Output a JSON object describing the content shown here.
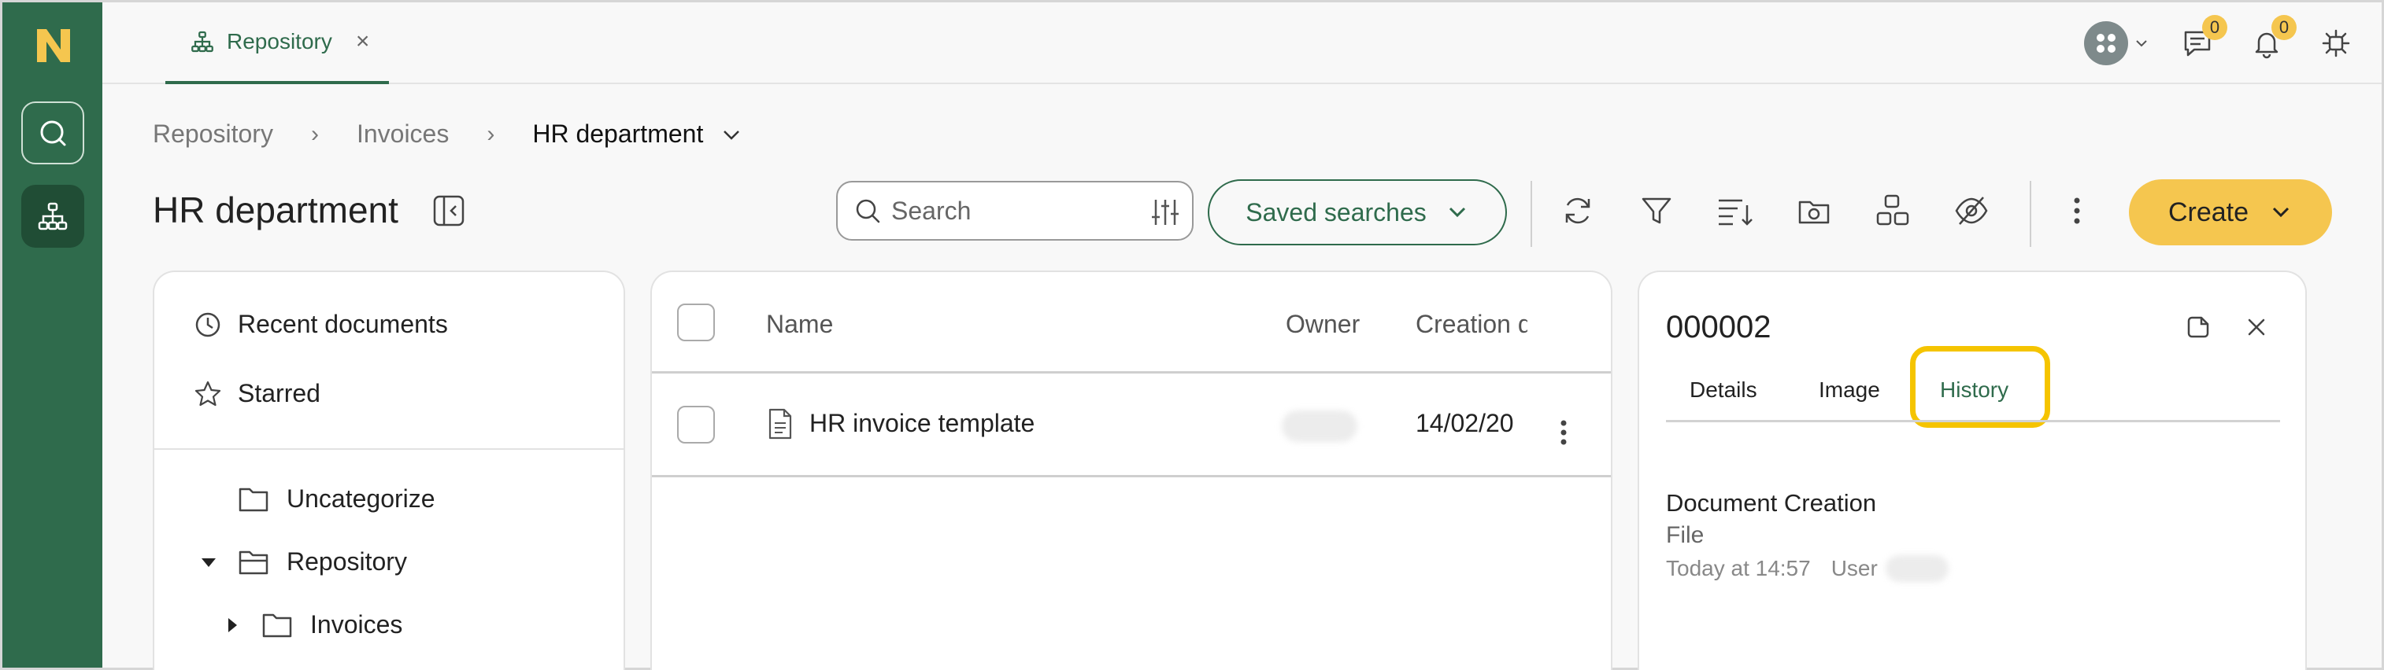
{
  "app": {
    "tab_label": "Repository",
    "tab_close": "×"
  },
  "header": {
    "messages_badge": "0",
    "notifications_badge": "0"
  },
  "breadcrumb": {
    "items": [
      "Repository",
      "Invoices"
    ],
    "current": "HR department",
    "separator": "›"
  },
  "page": {
    "title": "HR department"
  },
  "toolbar": {
    "search_placeholder": "Search",
    "saved_searches_label": "Saved searches",
    "create_label": "Create"
  },
  "left_panel": {
    "recent_label": "Recent documents",
    "starred_label": "Starred",
    "tree": [
      {
        "label": "Uncategorize",
        "expander": "none"
      },
      {
        "label": "Repository",
        "expander": "expanded"
      },
      {
        "label": "Invoices",
        "expander": "collapsed"
      }
    ]
  },
  "document_list": {
    "columns": [
      "Name",
      "Owner",
      "Creation d"
    ],
    "rows": [
      {
        "name": "HR invoice template",
        "owner": "",
        "creation": "14/02/20"
      }
    ]
  },
  "detail_panel": {
    "doc_id": "000002",
    "tabs": [
      "Details",
      "Image",
      "History"
    ],
    "active_tab": "History",
    "history": [
      {
        "event": "Document Creation",
        "type": "File",
        "time": "Today at 14:57",
        "user_label": "User"
      }
    ]
  },
  "colors": {
    "brand_green": "#2f6b4c",
    "accent_yellow": "#f5c64f",
    "highlight": "#f5c400"
  }
}
